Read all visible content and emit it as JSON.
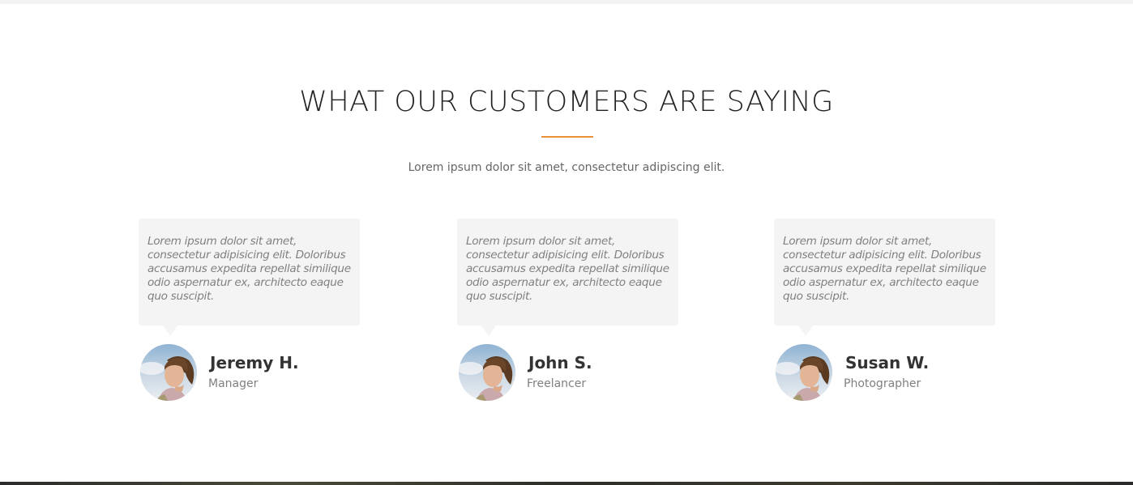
{
  "section": {
    "title": "WHAT OUR CUSTOMERS ARE SAYING",
    "subtitle": "Lorem ipsum dolor sit amet, consectetur adipiscing elit."
  },
  "colors": {
    "accent": "#e8913a",
    "quote_background": "#f4f4f4"
  },
  "testimonials": [
    {
      "quote": "Lorem ipsum dolor sit amet, consectetur adipisicing elit. Doloribus accusamus expedita repellat similique odio aspernatur ex, architecto eaque quo suscipit.",
      "name": "Jeremy H.",
      "role": "Manager",
      "avatar_icon": "user-avatar-photo"
    },
    {
      "quote": "Lorem ipsum dolor sit amet, consectetur adipisicing elit. Doloribus accusamus expedita repellat similique odio aspernatur ex, architecto eaque quo suscipit.",
      "name": "John S.",
      "role": "Freelancer",
      "avatar_icon": "user-avatar-photo"
    },
    {
      "quote": "Lorem ipsum dolor sit amet, consectetur adipisicing elit. Doloribus accusamus expedita repellat similique odio aspernatur ex, architecto eaque quo suscipit.",
      "name": "Susan W.",
      "role": "Photographer",
      "avatar_icon": "user-avatar-photo"
    }
  ]
}
